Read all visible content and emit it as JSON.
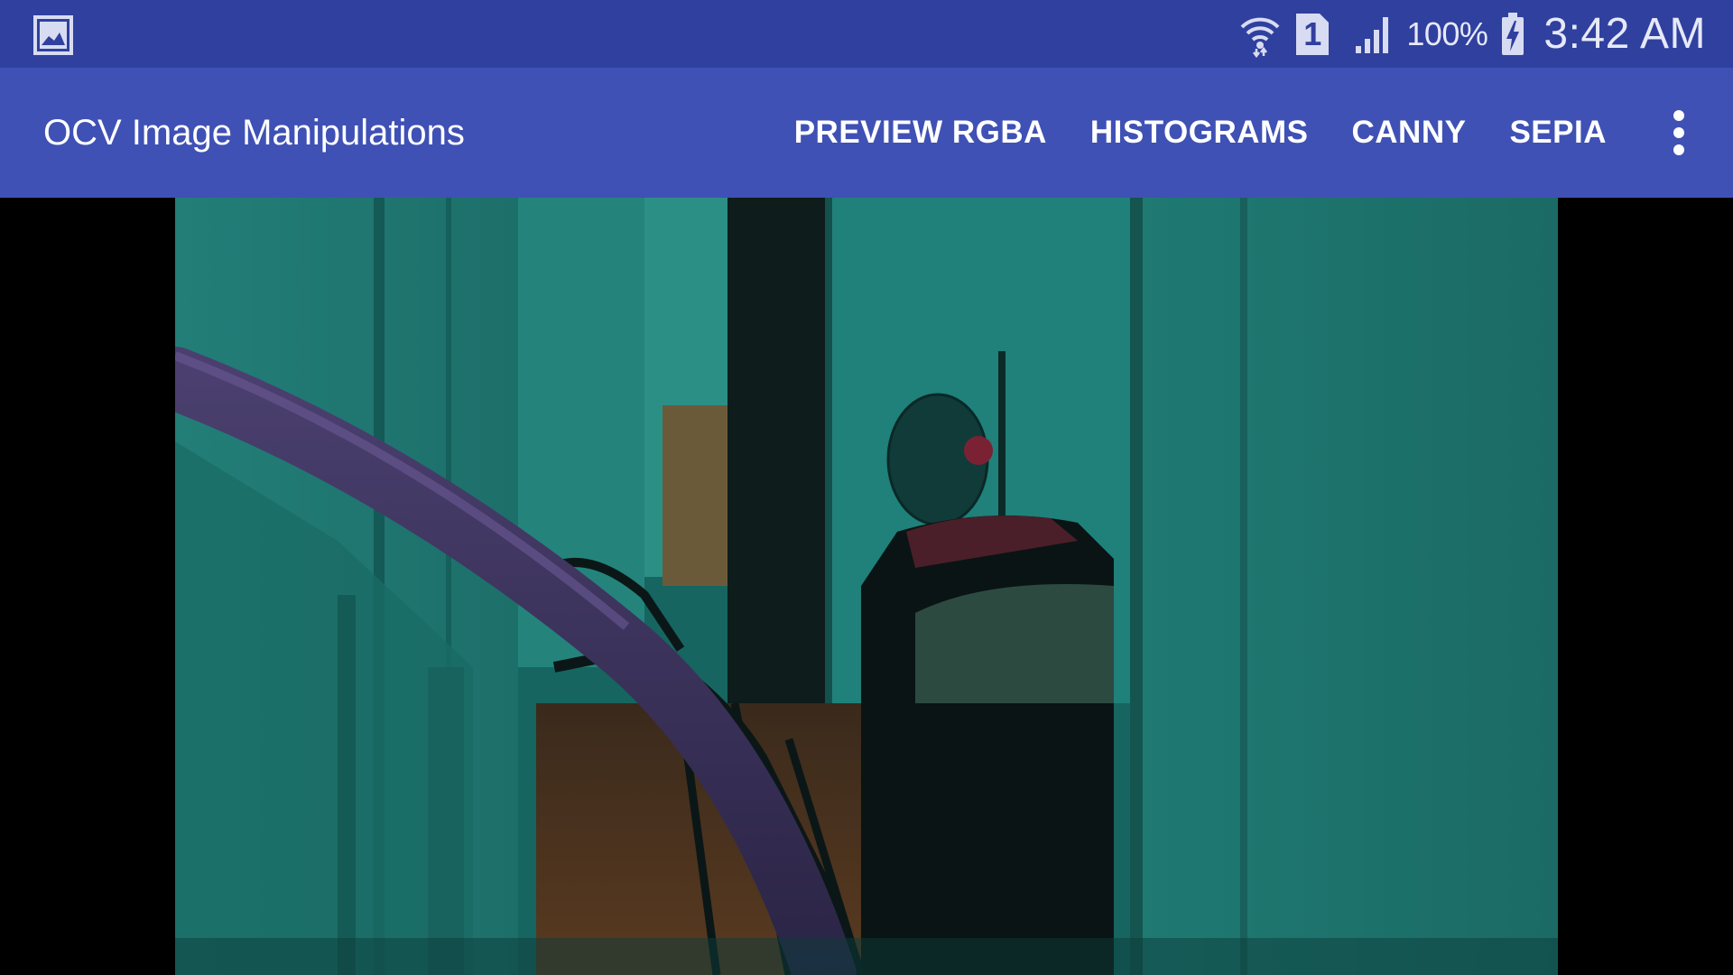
{
  "status_bar": {
    "left_icon": "gallery-icon",
    "icons": [
      "wifi-icon",
      "sim-1-icon",
      "signal-icon",
      "battery-charging-icon"
    ],
    "sim_number": "1",
    "battery_percent": "100%",
    "time": "3:42 AM"
  },
  "app_bar": {
    "title": "OCV Image Manipulations",
    "actions": [
      "PREVIEW RGBA",
      "HISTOGRAMS",
      "CANNY",
      "SEPIA"
    ],
    "overflow_icon": "more-vert-icon"
  },
  "colors": {
    "status_bar": "#30409f",
    "app_bar": "#3f51b5",
    "background": "#000000",
    "camera_tint": "#1a6b66"
  }
}
